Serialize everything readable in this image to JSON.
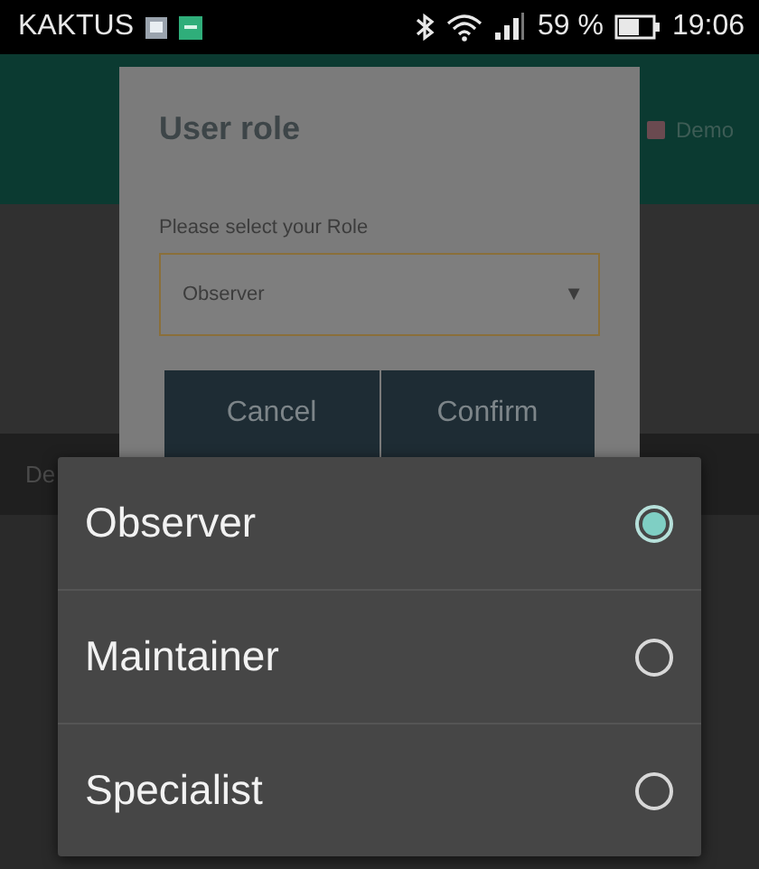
{
  "status_bar": {
    "carrier": "KAKTUS",
    "battery": "59 %",
    "time": "19:06"
  },
  "background": {
    "demo_checked": true,
    "header_label": "Demo",
    "tab_label": "De"
  },
  "dialog": {
    "title": "User role",
    "label": "Please select your Role",
    "select": {
      "value": "Observer",
      "caret": "▼"
    },
    "buttons": [
      "Cancel",
      "Confirm"
    ]
  },
  "options": [
    {
      "label": "Observer",
      "selected": true
    },
    {
      "label": "Maintainer",
      "selected": false
    },
    {
      "label": "Specialist",
      "selected": false
    }
  ]
}
